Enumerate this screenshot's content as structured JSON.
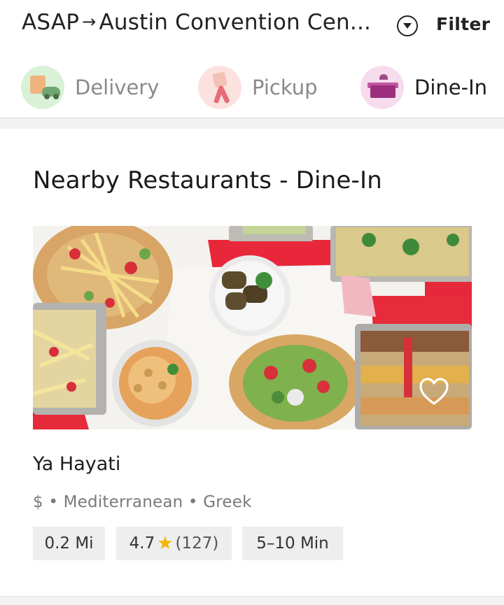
{
  "header": {
    "time": "ASAP",
    "arrow": "→",
    "location": "Austin Convention Cen...",
    "filter_label": "Filter"
  },
  "tabs": [
    {
      "label": "Delivery",
      "icon": "delivery-icon",
      "active": false
    },
    {
      "label": "Pickup",
      "icon": "pickup-icon",
      "active": false
    },
    {
      "label": "Dine-In",
      "icon": "dine-in-icon",
      "active": true
    }
  ],
  "section": {
    "title": "Nearby Restaurants - Dine-In"
  },
  "restaurant": {
    "name": "Ya Hayati",
    "price": "$",
    "cuisine1": "Mediterranean",
    "cuisine2": "Greek",
    "distance": "0.2 Mi",
    "rating": "4.7",
    "reviews": "(127)",
    "eta": "5–10 Min",
    "favorite_icon": "heart-outline-icon"
  },
  "colors": {
    "accent_star": "#f4b400",
    "chip_bg": "#eeeeee"
  }
}
